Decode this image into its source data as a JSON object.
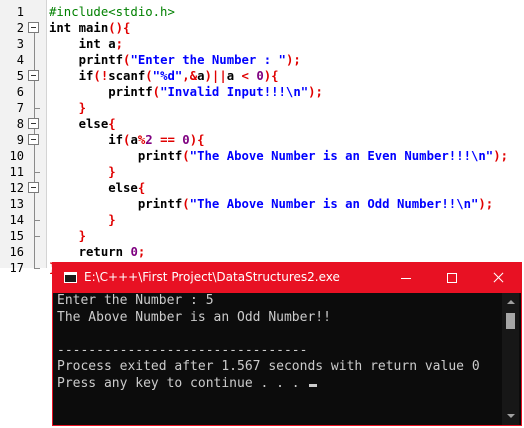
{
  "editor": {
    "line_numbers": [
      "1",
      "2",
      "3",
      "4",
      "5",
      "6",
      "7",
      "8",
      "9",
      "10",
      "11",
      "12",
      "13",
      "14",
      "15",
      "16",
      "17"
    ],
    "lines": [
      [
        {
          "t": "#include<stdio.h>",
          "c": "pp"
        }
      ],
      [
        {
          "t": "int main",
          "c": "kw"
        },
        {
          "t": "(){",
          "c": "op"
        }
      ],
      [
        {
          "t": "    int a",
          "c": "kw"
        },
        {
          "t": ";",
          "c": "op"
        }
      ],
      [
        {
          "t": "    printf",
          "c": "kw"
        },
        {
          "t": "(",
          "c": "op"
        },
        {
          "t": "\"Enter the Number : \"",
          "c": "str"
        },
        {
          "t": ");",
          "c": "op"
        }
      ],
      [
        {
          "t": "    if",
          "c": "kw"
        },
        {
          "t": "(!",
          "c": "op"
        },
        {
          "t": "scanf",
          "c": "kw"
        },
        {
          "t": "(",
          "c": "op"
        },
        {
          "t": "\"%d\"",
          "c": "str"
        },
        {
          "t": ",&",
          "c": "op"
        },
        {
          "t": "a",
          "c": "kw"
        },
        {
          "t": ")||",
          "c": "op"
        },
        {
          "t": "a ",
          "c": "kw"
        },
        {
          "t": "< ",
          "c": "op"
        },
        {
          "t": "0",
          "c": "num"
        },
        {
          "t": "){",
          "c": "op"
        }
      ],
      [
        {
          "t": "        printf",
          "c": "kw"
        },
        {
          "t": "(",
          "c": "op"
        },
        {
          "t": "\"Invalid Input!!!\\n\"",
          "c": "str"
        },
        {
          "t": ");",
          "c": "op"
        }
      ],
      [
        {
          "t": "    ",
          "c": "kw"
        },
        {
          "t": "}",
          "c": "op"
        }
      ],
      [
        {
          "t": "    else",
          "c": "kw"
        },
        {
          "t": "{",
          "c": "op"
        }
      ],
      [
        {
          "t": "        if",
          "c": "kw"
        },
        {
          "t": "(",
          "c": "op"
        },
        {
          "t": "a",
          "c": "kw"
        },
        {
          "t": "%",
          "c": "op"
        },
        {
          "t": "2 ",
          "c": "num"
        },
        {
          "t": "== ",
          "c": "op"
        },
        {
          "t": "0",
          "c": "num"
        },
        {
          "t": "){",
          "c": "op"
        }
      ],
      [
        {
          "t": "            printf",
          "c": "kw"
        },
        {
          "t": "(",
          "c": "op"
        },
        {
          "t": "\"The Above Number is an Even Number!!!\\n\"",
          "c": "str"
        },
        {
          "t": ");",
          "c": "op"
        }
      ],
      [
        {
          "t": "        ",
          "c": "kw"
        },
        {
          "t": "}",
          "c": "op"
        }
      ],
      [
        {
          "t": "        else",
          "c": "kw"
        },
        {
          "t": "{",
          "c": "op"
        }
      ],
      [
        {
          "t": "            printf",
          "c": "kw"
        },
        {
          "t": "(",
          "c": "op"
        },
        {
          "t": "\"The Above Number is an Odd Number!!\\n\"",
          "c": "str"
        },
        {
          "t": ");",
          "c": "op"
        }
      ],
      [
        {
          "t": "        ",
          "c": "kw"
        },
        {
          "t": "}",
          "c": "op"
        }
      ],
      [
        {
          "t": "    ",
          "c": "kw"
        },
        {
          "t": "}",
          "c": "op"
        }
      ],
      [
        {
          "t": "    return ",
          "c": "kw"
        },
        {
          "t": "0",
          "c": "num"
        },
        {
          "t": ";",
          "c": "op"
        }
      ],
      [
        {
          "t": "}",
          "c": "op"
        }
      ]
    ]
  },
  "console": {
    "title": "E:\\C+++\\First Project\\DataStructures2.exe",
    "lines": [
      "Enter the Number : 5",
      "The Above Number is an Odd Number!!",
      "",
      "--------------------------------",
      "Process exited after 1.567 seconds with return value 0",
      "Press any key to continue . . . "
    ]
  },
  "colors": {
    "accent": "#e81123",
    "string": "#0000ff",
    "operator": "#e00000",
    "number": "#7e0080",
    "preprocessor": "#008000"
  },
  "icons": {
    "app": "console-app-icon",
    "minimize": "minimize-icon",
    "maximize": "maximize-icon",
    "close": "close-icon"
  }
}
